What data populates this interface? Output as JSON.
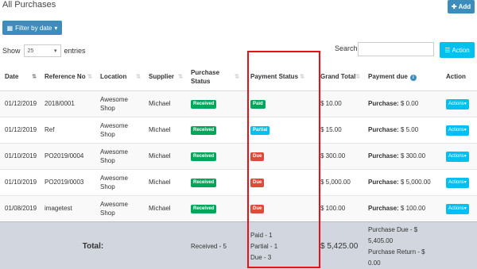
{
  "page": {
    "title": "All Purchases"
  },
  "toolbar": {
    "add_label": "Add",
    "filter_label": "Filter by date",
    "show_label": "Show",
    "entries_value": "25",
    "entries_label": "entries",
    "search_label": "Search:",
    "action_label": "Action"
  },
  "table": {
    "headers": {
      "date": "Date",
      "reference_no": "Reference No",
      "location": "Location",
      "supplier": "Supplier",
      "purchase_status": "Purchase Status",
      "payment_status": "Payment Status",
      "grand_total": "Grand Total",
      "payment_due": "Payment due",
      "action": "Action"
    },
    "rows": [
      {
        "date": "01/12/2019",
        "reference_no": "2018/0001",
        "location": "Awesome Shop",
        "supplier": "Michael",
        "purchase_status": "Received",
        "payment_status": "Paid",
        "grand_total": "$ 10.00",
        "payment_due_label": "Purchase:",
        "payment_due_value": "$ 0.00",
        "action": "Actions"
      },
      {
        "date": "01/12/2019",
        "reference_no": "Ref",
        "location": "Awesome Shop",
        "supplier": "Michael",
        "purchase_status": "Received",
        "payment_status": "Partial",
        "grand_total": "$ 15.00",
        "payment_due_label": "Purchase:",
        "payment_due_value": "$ 5.00",
        "action": "Actions"
      },
      {
        "date": "01/10/2019",
        "reference_no": "PO2019/0004",
        "location": "Awesome Shop",
        "supplier": "Michael",
        "purchase_status": "Received",
        "payment_status": "Due",
        "grand_total": "$ 300.00",
        "payment_due_label": "Purchase:",
        "payment_due_value": "$ 300.00",
        "action": "Actions"
      },
      {
        "date": "01/10/2019",
        "reference_no": "PO2019/0003",
        "location": "Awesome Shop",
        "supplier": "Michael",
        "purchase_status": "Received",
        "payment_status": "Due",
        "grand_total": "$ 5,000.00",
        "payment_due_label": "Purchase:",
        "payment_due_value": "$ 5,000.00",
        "action": "Actions"
      },
      {
        "date": "01/08/2019",
        "reference_no": "imagetest",
        "location": "Awesome Shop",
        "supplier": "Michael",
        "purchase_status": "Received",
        "payment_status": "Due",
        "grand_total": "$ 100.00",
        "payment_due_label": "Purchase:",
        "payment_due_value": "$ 100.00",
        "action": "Actions"
      }
    ],
    "footer": {
      "total_label": "Total:",
      "purchase_status_summary": "Received - 5",
      "payment_paid": "Paid - 1",
      "payment_partial": "Partial - 1",
      "payment_due": "Due - 3",
      "grand_total": "$ 5,425.00",
      "purchase_due_line1": "Purchase Due - $",
      "purchase_due_line2": "5,405.00",
      "purchase_return": "Purchase Return - $ 0.00"
    }
  },
  "colors": {
    "primary": "#3c8dbc",
    "info": "#00c0ef",
    "success": "#00a65a",
    "danger": "#dd4b39",
    "highlight": "#e8111a"
  }
}
